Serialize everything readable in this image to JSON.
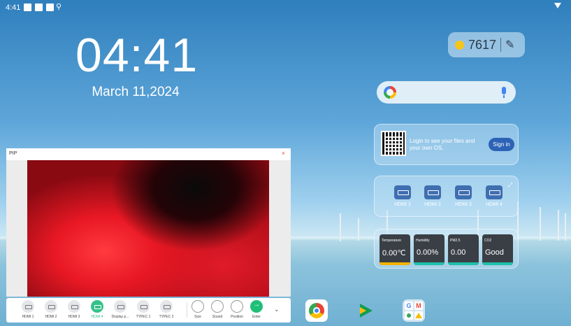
{
  "status_bar": {
    "time": "4:41"
  },
  "clock": {
    "time": "04:41",
    "date": "March 11,2024"
  },
  "weather": {
    "value": "7617"
  },
  "login_card": {
    "text": "Login to see your files and your own OS.",
    "button": "Sign in"
  },
  "hdmi_card": {
    "inputs": [
      "HDMI 1",
      "HDMI 2",
      "HDMI 3",
      "HDMI 4"
    ]
  },
  "sensors": [
    {
      "title": "Temperature",
      "value": "0.00℃",
      "color": "#f4b400"
    },
    {
      "title": "Humidity",
      "value": "0.00%",
      "color": "#1fbfa8"
    },
    {
      "title": "PM2.5",
      "value": "0.00",
      "color": "#1fbfa8"
    },
    {
      "title": "CO2",
      "value": "Good",
      "color": "#1fbfa8"
    }
  ],
  "pip": {
    "title": "PIP",
    "close": "×"
  },
  "toolbar": {
    "sources": [
      "HDMI 1",
      "HDMI 2",
      "HDMI 3",
      "HDMI 4",
      "Display p...",
      "TYPEC 1",
      "TYPEC 2"
    ],
    "active_source": "HDMI 4",
    "actions": [
      "Size",
      "Sound",
      "Position",
      "Enter"
    ]
  },
  "dock": {
    "apps": [
      "chrome-icon",
      "play-store-icon",
      "google-apps-folder-icon"
    ]
  }
}
